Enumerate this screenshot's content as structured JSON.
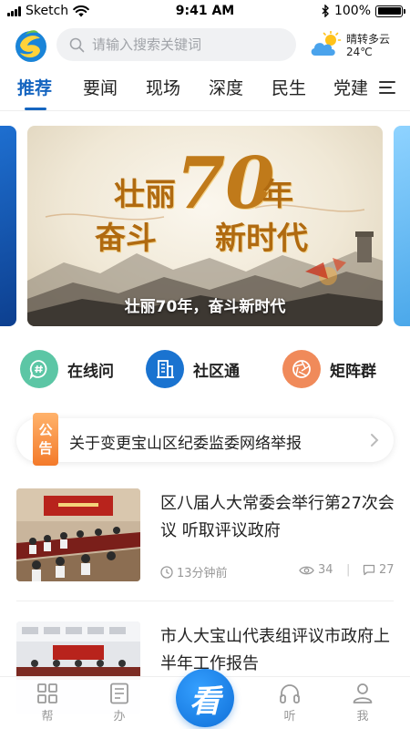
{
  "status_bar": {
    "carrier": "Sketch",
    "time": "9:41 AM",
    "battery": "100%",
    "icons": [
      "signal-icon",
      "wifi-icon",
      "bluetooth-icon",
      "battery-icon"
    ]
  },
  "header": {
    "search_placeholder": "请输入搜索关键词",
    "weather_desc": "晴转多云",
    "weather_temp": "24℃"
  },
  "tabs": [
    {
      "label": "推荐",
      "active": true
    },
    {
      "label": "要闻",
      "active": false
    },
    {
      "label": "现场",
      "active": false
    },
    {
      "label": "深度",
      "active": false
    },
    {
      "label": "民生",
      "active": false
    },
    {
      "label": "党建",
      "active": false
    }
  ],
  "banner": {
    "title_line1": "壮丽",
    "title_num": "70",
    "title_line1_end": "年",
    "title_line2_left": "奋斗",
    "title_line2_right": "新时代",
    "caption": "壮丽70年，奋斗新时代"
  },
  "quick_links": [
    {
      "label": "在线问",
      "icon": "chat-hash-icon",
      "color": "#5cc6a5"
    },
    {
      "label": "社区通",
      "icon": "building-icon",
      "color": "#1a73d0"
    },
    {
      "label": "矩阵群",
      "icon": "aperture-icon",
      "color": "#f08a5a"
    }
  ],
  "notice": {
    "tag_line1": "公",
    "tag_line2": "告",
    "text": "关于变更宝山区纪委监委网络举报"
  },
  "news": [
    {
      "title": "区八届人大常委会举行第27次会议 听取评议政府",
      "time": "13分钟前",
      "views": "34",
      "comments": "27"
    },
    {
      "title": "市人大宝山代表组评议市政府上半年工作报告",
      "time": "",
      "views": "",
      "comments": ""
    }
  ],
  "bottom_nav": {
    "items": [
      {
        "label": "帮",
        "icon": "grid-icon"
      },
      {
        "label": "办",
        "icon": "document-icon"
      },
      {
        "label": "听",
        "icon": "headphones-icon"
      },
      {
        "label": "我",
        "icon": "person-icon"
      }
    ],
    "center_label": "看"
  },
  "colors": {
    "accent": "#1565c0",
    "notice_tag": "#f37a2a",
    "muted": "#999999"
  }
}
